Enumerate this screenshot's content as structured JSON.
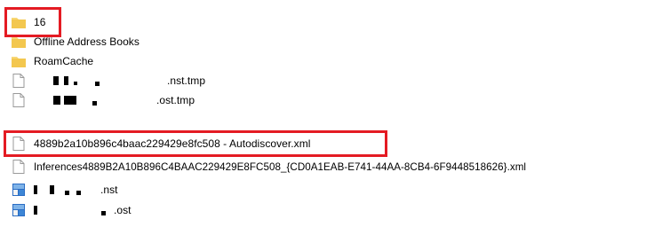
{
  "files": [
    {
      "name": "16",
      "icon": "folder-icon"
    },
    {
      "name": "Offline Address Books",
      "icon": "folder-icon"
    },
    {
      "name": "RoamCache",
      "icon": "folder-icon"
    },
    {
      "name": ".nst.tmp",
      "icon": "file-icon",
      "redacted": true
    },
    {
      "name": ".ost.tmp",
      "icon": "file-icon",
      "redacted": true
    },
    {
      "name": "4889b2a10b896c4baac229429e8fc508 - Autodiscover.xml",
      "icon": "file-icon"
    },
    {
      "name": "Inferences4889B2A10B896C4BAAC229429E8FC508_{CD0A1EAB-E741-44AA-8CB4-6F9448518626}.xml",
      "icon": "file-icon"
    },
    {
      "name": ".nst",
      "icon": "outlook-file-icon",
      "redacted": true
    },
    {
      "name": ".ost",
      "icon": "outlook-file-icon",
      "redacted": true
    }
  ],
  "highlight_color": "#e41b23",
  "folder_color": "#f3c74f"
}
